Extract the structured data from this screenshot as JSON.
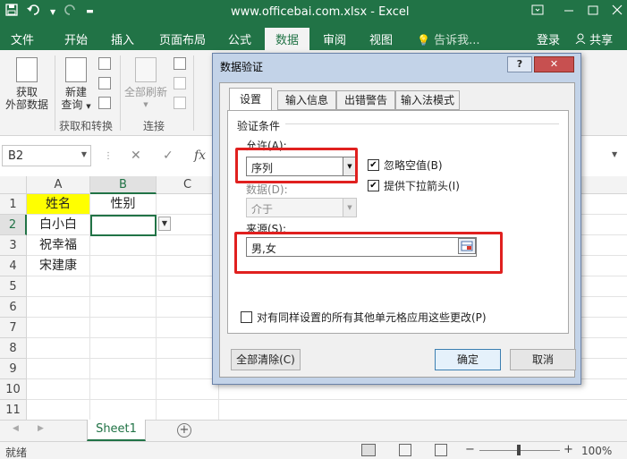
{
  "window": {
    "title": "www.officebai.com.xlsx - Excel",
    "qat_icons": [
      "save-icon",
      "undo-icon",
      "redo-icon",
      "customize-icon"
    ]
  },
  "ribbon": {
    "tabs": [
      {
        "label": "文件"
      },
      {
        "label": "开始"
      },
      {
        "label": "插入"
      },
      {
        "label": "页面布局"
      },
      {
        "label": "公式"
      },
      {
        "label": "数据"
      },
      {
        "label": "审阅"
      },
      {
        "label": "视图"
      },
      {
        "label": "告诉我..."
      }
    ],
    "active_tab": "数据",
    "login": "登录",
    "share": "共享",
    "buttons": {
      "get_data_line1": "获取",
      "get_data_line2": "外部数据",
      "new_query_line1": "新建",
      "new_query_line2": "查询",
      "refresh_all": "全部刷新"
    },
    "groups": {
      "get_transform": "获取和转换",
      "connections": "连接"
    }
  },
  "formula_bar": {
    "name_box": "B2",
    "fx": "fx",
    "cancel_icon": "✕",
    "enter_icon": "✓"
  },
  "sheet": {
    "columns": [
      "A",
      "B",
      "C"
    ],
    "rows": [
      "1",
      "2",
      "3",
      "4",
      "5",
      "6",
      "7",
      "8",
      "9",
      "10",
      "11"
    ],
    "cells": {
      "A1": "姓名",
      "B1": "性别",
      "A2": "白小白",
      "A3": "祝幸福",
      "A4": "宋建康"
    },
    "active_cell": "B2",
    "highlight_color": "#ffff00"
  },
  "sheet_tabs": {
    "active": "Sheet1"
  },
  "status_bar": {
    "status": "就绪",
    "zoom": "100%"
  },
  "dialog": {
    "title": "数据验证",
    "help": "?",
    "tabs": [
      {
        "label": "设置"
      },
      {
        "label": "输入信息"
      },
      {
        "label": "出错警告"
      },
      {
        "label": "输入法模式"
      }
    ],
    "active_tab": "设置",
    "section_title": "验证条件",
    "allow_label": "允许(A):",
    "allow_value": "序列",
    "ignore_blank": {
      "label": "忽略空值(B)",
      "checked": true
    },
    "in_cell_dropdown": {
      "label": "提供下拉箭头(I)",
      "checked": true
    },
    "data_label": "数据(D):",
    "data_value": "介于",
    "source_label": "来源(S):",
    "source_value": "男,女",
    "apply_all_label": "对有同样设置的所有其他单元格应用这些更改(P)",
    "apply_all_checked": false,
    "clear_all": "全部清除(C)",
    "ok": "确定",
    "cancel": "取消",
    "highlight_color": "#e0201f"
  },
  "colors": {
    "excel_green": "#217346",
    "ribbon_bg": "#f3f3f3",
    "dialog_frame": "#c3d3e8",
    "close_button": "#c75050"
  }
}
